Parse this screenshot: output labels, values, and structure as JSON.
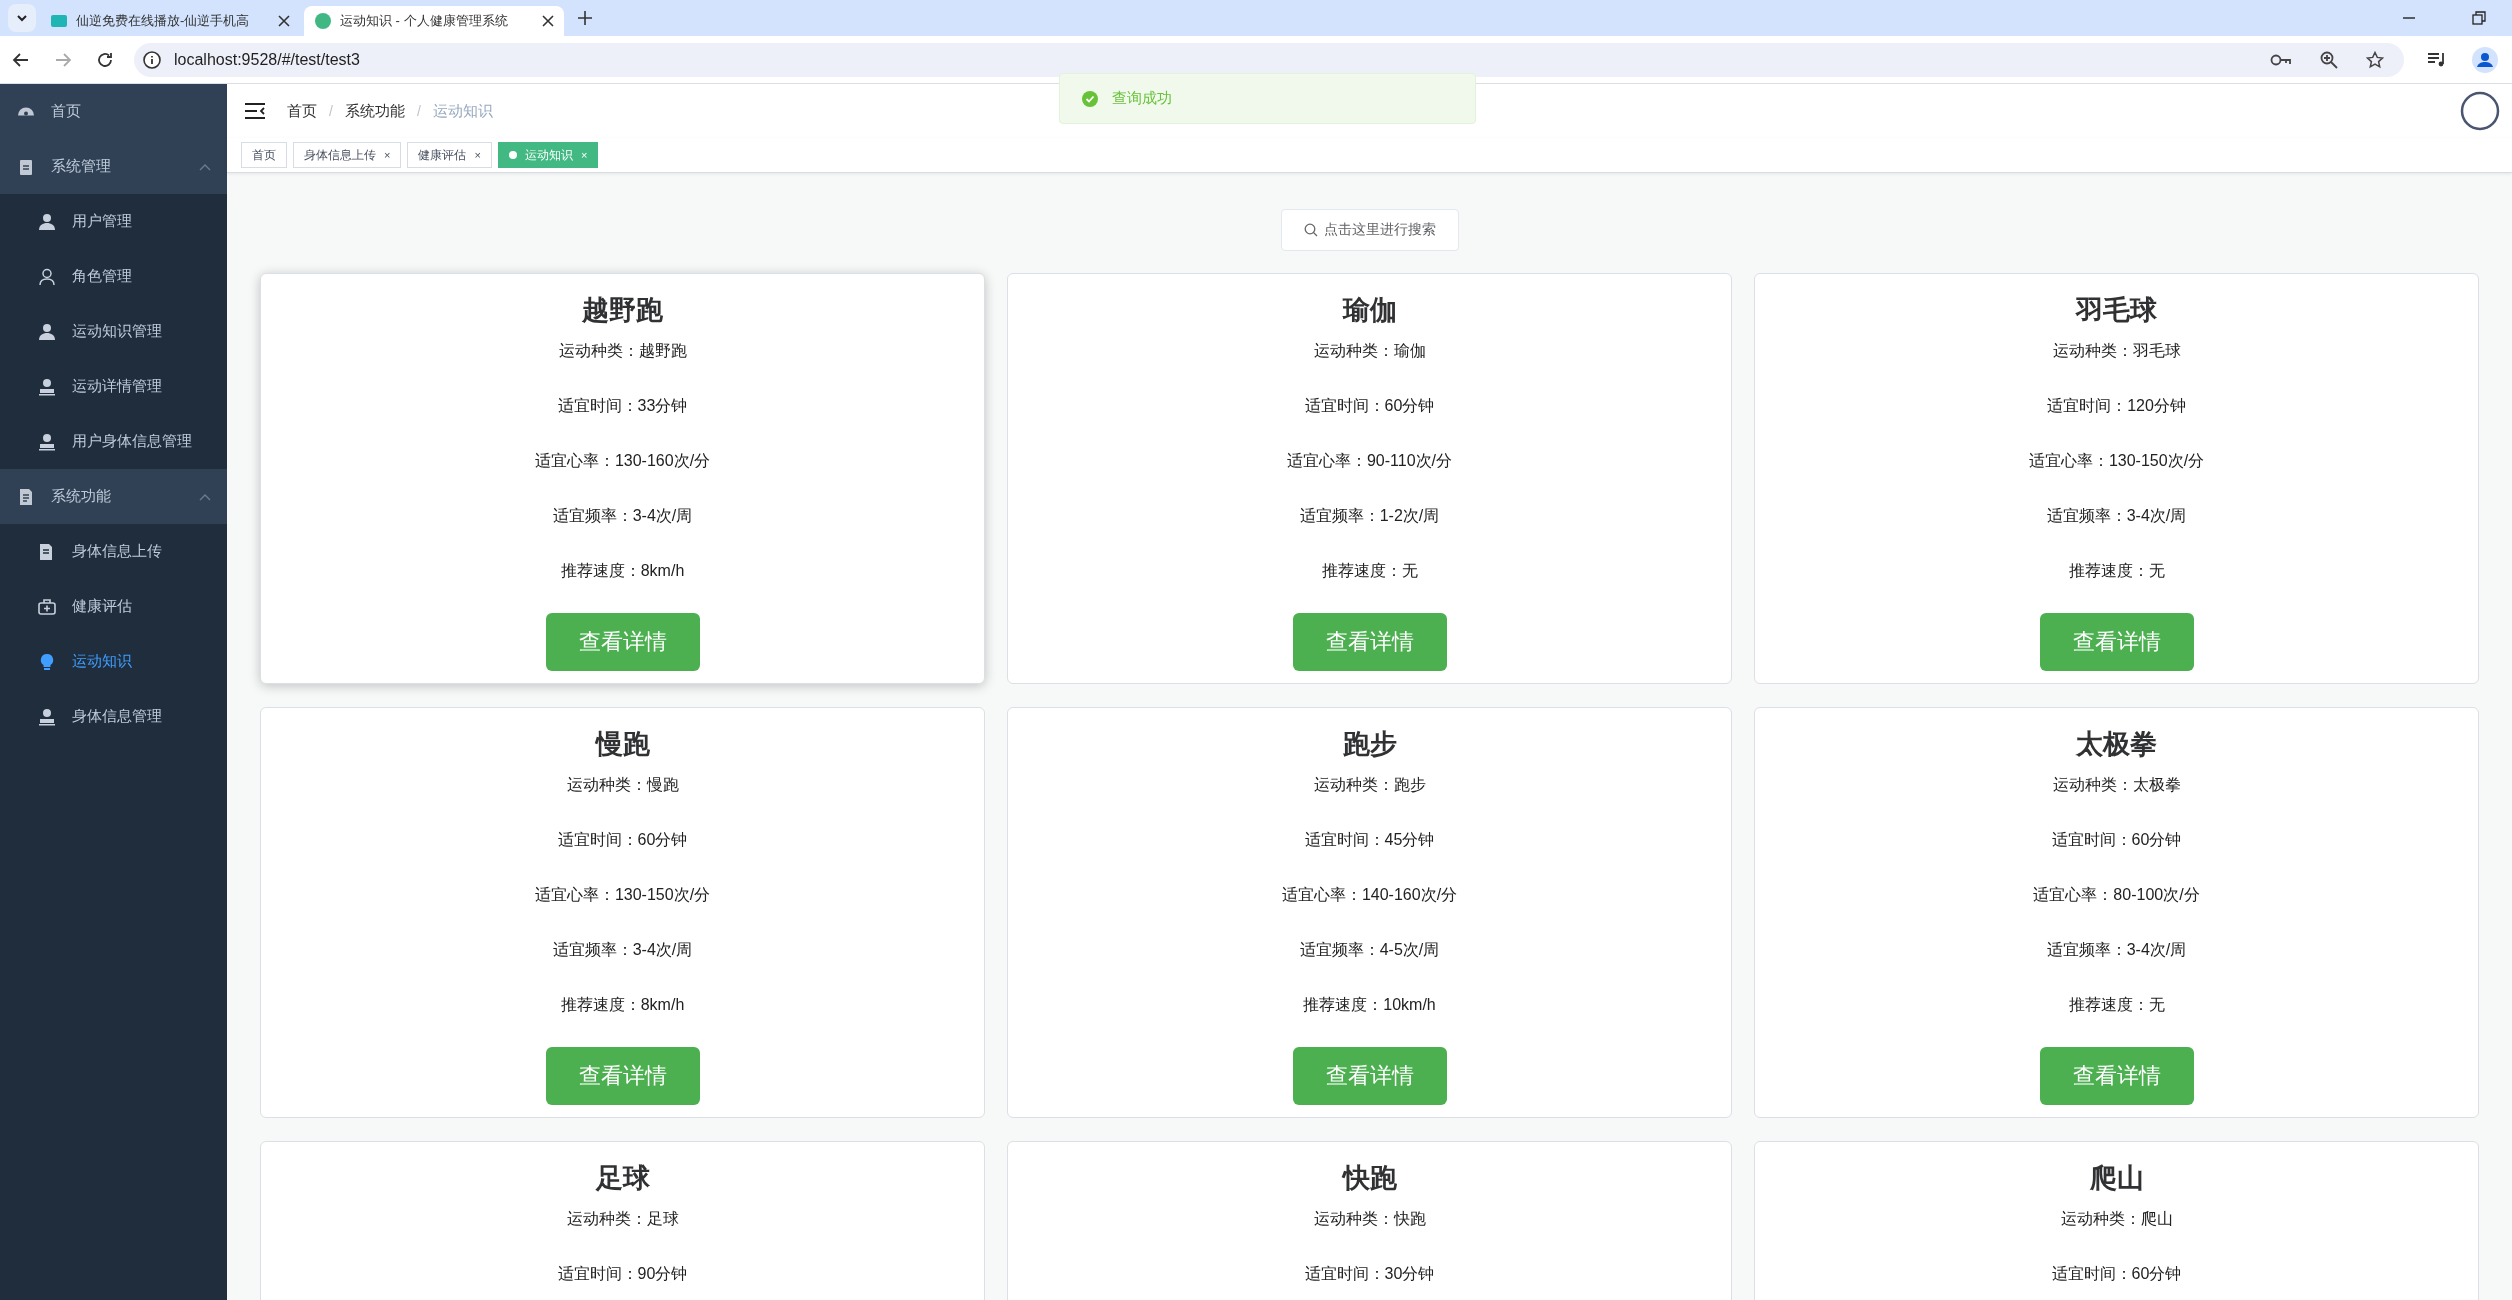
{
  "browser": {
    "tabs": [
      {
        "title": "仙逆免费在线播放-仙逆手机高",
        "selected": false
      },
      {
        "title": "运动知识 - 个人健康管理系统",
        "selected": true
      }
    ],
    "url": "localhost:9528/#/test/test3"
  },
  "sidebar": {
    "items": [
      {
        "label": "首页",
        "selected": false
      },
      {
        "label": "系统管理",
        "expanded": true,
        "children": [
          {
            "label": "用户管理",
            "selected": false
          },
          {
            "label": "角色管理",
            "selected": false
          },
          {
            "label": "运动知识管理",
            "selected": false
          },
          {
            "label": "运动详情管理",
            "selected": false
          },
          {
            "label": "用户身体信息管理",
            "selected": false
          }
        ]
      },
      {
        "label": "系统功能",
        "expanded": true,
        "children": [
          {
            "label": "身体信息上传",
            "selected": false
          },
          {
            "label": "健康评估",
            "selected": false
          },
          {
            "label": "运动知识",
            "selected": true
          },
          {
            "label": "身体信息管理",
            "selected": false
          }
        ]
      }
    ]
  },
  "breadcrumb": {
    "separator": "/",
    "items": [
      "首页",
      "系统功能",
      "运动知识"
    ]
  },
  "tags": [
    {
      "label": "首页",
      "closable": false,
      "selected": false
    },
    {
      "label": "身体信息上传",
      "closable": true,
      "selected": false
    },
    {
      "label": "健康评估",
      "closable": true,
      "selected": false
    },
    {
      "label": "运动知识",
      "closable": true,
      "selected": true
    }
  ],
  "close_glyph": "×",
  "toast": {
    "message": "查询成功"
  },
  "search": {
    "label": "点击这里进行搜索"
  },
  "cards": [
    {
      "title": "越野跑",
      "hovered": true,
      "lines": [
        "运动种类：越野跑",
        "适宜时间：33分钟",
        "适宜心率：130-160次/分",
        "适宜频率：3-4次/周",
        "推荐速度：8km/h"
      ],
      "button": "查看详情"
    },
    {
      "title": "瑜伽",
      "hovered": false,
      "lines": [
        "运动种类：瑜伽",
        "适宜时间：60分钟",
        "适宜心率：90-110次/分",
        "适宜频率：1-2次/周",
        "推荐速度：无"
      ],
      "button": "查看详情"
    },
    {
      "title": "羽毛球",
      "hovered": false,
      "lines": [
        "运动种类：羽毛球",
        "适宜时间：120分钟",
        "适宜心率：130-150次/分",
        "适宜频率：3-4次/周",
        "推荐速度：无"
      ],
      "button": "查看详情"
    },
    {
      "title": "慢跑",
      "hovered": false,
      "lines": [
        "运动种类：慢跑",
        "适宜时间：60分钟",
        "适宜心率：130-150次/分",
        "适宜频率：3-4次/周",
        "推荐速度：8km/h"
      ],
      "button": "查看详情"
    },
    {
      "title": "跑步",
      "hovered": false,
      "lines": [
        "运动种类：跑步",
        "适宜时间：45分钟",
        "适宜心率：140-160次/分",
        "适宜频率：4-5次/周",
        "推荐速度：10km/h"
      ],
      "button": "查看详情"
    },
    {
      "title": "太极拳",
      "hovered": false,
      "lines": [
        "运动种类：太极拳",
        "适宜时间：60分钟",
        "适宜心率：80-100次/分",
        "适宜频率：3-4次/周",
        "推荐速度：无"
      ],
      "button": "查看详情"
    },
    {
      "title": "足球",
      "hovered": false,
      "lines": [
        "运动种类：足球",
        "适宜时间：90分钟"
      ]
    },
    {
      "title": "快跑",
      "hovered": false,
      "lines": [
        "运动种类：快跑",
        "适宜时间：30分钟"
      ]
    },
    {
      "title": "爬山",
      "hovered": false,
      "lines": [
        "运动种类：爬山",
        "适宜时间：60分钟"
      ]
    }
  ]
}
